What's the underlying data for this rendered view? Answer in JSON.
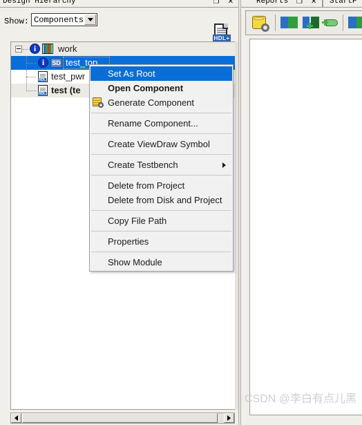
{
  "left_panel": {
    "title": "Design Hierarchy",
    "titlebar_buttons": "❐ ✕",
    "show_label": "Show:",
    "show_value": "Components",
    "show_options": [
      "Components"
    ],
    "new_hdl_icon": "new-hdl-file-icon",
    "new_hdl_badge": "HDL+",
    "tree": {
      "rows": [
        {
          "label": "work",
          "indent": 0,
          "icons": [
            "info-icon",
            "library-icon"
          ],
          "selected": false,
          "bold": false,
          "stripe": true
        },
        {
          "label": "test_top",
          "indent": 1,
          "icons": [
            "info-icon",
            "sd-badge-icon"
          ],
          "sd_badge": "SD",
          "selected": true,
          "bold": false,
          "stripe": false
        },
        {
          "label": "test_pwr",
          "indent": 1,
          "icons": [
            "hdl-file-icon"
          ],
          "hdl_badge": "HDL",
          "selected": false,
          "bold": false,
          "stripe": false
        },
        {
          "label": "test (te",
          "indent": 1,
          "icons": [
            "hdl-file-icon"
          ],
          "hdl_badge": "HDL",
          "selected": false,
          "bold": true,
          "stripe": true
        }
      ]
    },
    "hscrollbar": {
      "left_arrow": "◀",
      "right_arrow": "▶"
    }
  },
  "context_menu": {
    "items": [
      {
        "label": "Set As Root",
        "highlight": true,
        "bold": false,
        "icon": null,
        "submenu": false,
        "sep_after": false
      },
      {
        "label": "Open Component",
        "highlight": false,
        "bold": true,
        "icon": null,
        "submenu": false,
        "sep_after": false
      },
      {
        "label": "Generate Component",
        "highlight": false,
        "bold": false,
        "icon": "generate-component-icon",
        "submenu": false,
        "sep_after": true
      },
      {
        "label": "Rename Component...",
        "highlight": false,
        "bold": false,
        "icon": null,
        "submenu": false,
        "sep_after": true
      },
      {
        "label": "Create ViewDraw Symbol",
        "highlight": false,
        "bold": false,
        "icon": null,
        "submenu": false,
        "sep_after": true
      },
      {
        "label": "Create Testbench",
        "highlight": false,
        "bold": false,
        "icon": null,
        "submenu": true,
        "sep_after": true
      },
      {
        "label": "Delete from Project",
        "highlight": false,
        "bold": false,
        "icon": null,
        "submenu": false,
        "sep_after": false
      },
      {
        "label": "Delete from Disk and Project",
        "highlight": false,
        "bold": false,
        "icon": null,
        "submenu": false,
        "sep_after": true
      },
      {
        "label": "Copy File Path",
        "highlight": false,
        "bold": false,
        "icon": null,
        "submenu": false,
        "sep_after": true
      },
      {
        "label": "Properties",
        "highlight": false,
        "bold": false,
        "icon": null,
        "submenu": false,
        "sep_after": true
      },
      {
        "label": "Show Module",
        "highlight": false,
        "bold": false,
        "icon": null,
        "submenu": false,
        "sep_after": false
      }
    ]
  },
  "right_panel": {
    "tabs": [
      {
        "label": "Reports"
      },
      {
        "label": "StartP"
      }
    ],
    "tab_buttons": "❐ ✕",
    "toolbar_icons": [
      "database-settings-icon",
      "import-arrow-icon",
      "add-arrow-icon",
      "add-tag-icon",
      "export-arrow-icon"
    ]
  },
  "watermark": "CSDN @李白有点儿黑",
  "colors": {
    "selection_blue": "#0a6ed8",
    "panel_bg": "#f1efe9",
    "stripe": "#eceae4",
    "border": "#9e9b93",
    "icon_blue": "#2a6fc4",
    "icon_green": "#2e9e3f",
    "icon_yellow": "#f5d93f"
  }
}
